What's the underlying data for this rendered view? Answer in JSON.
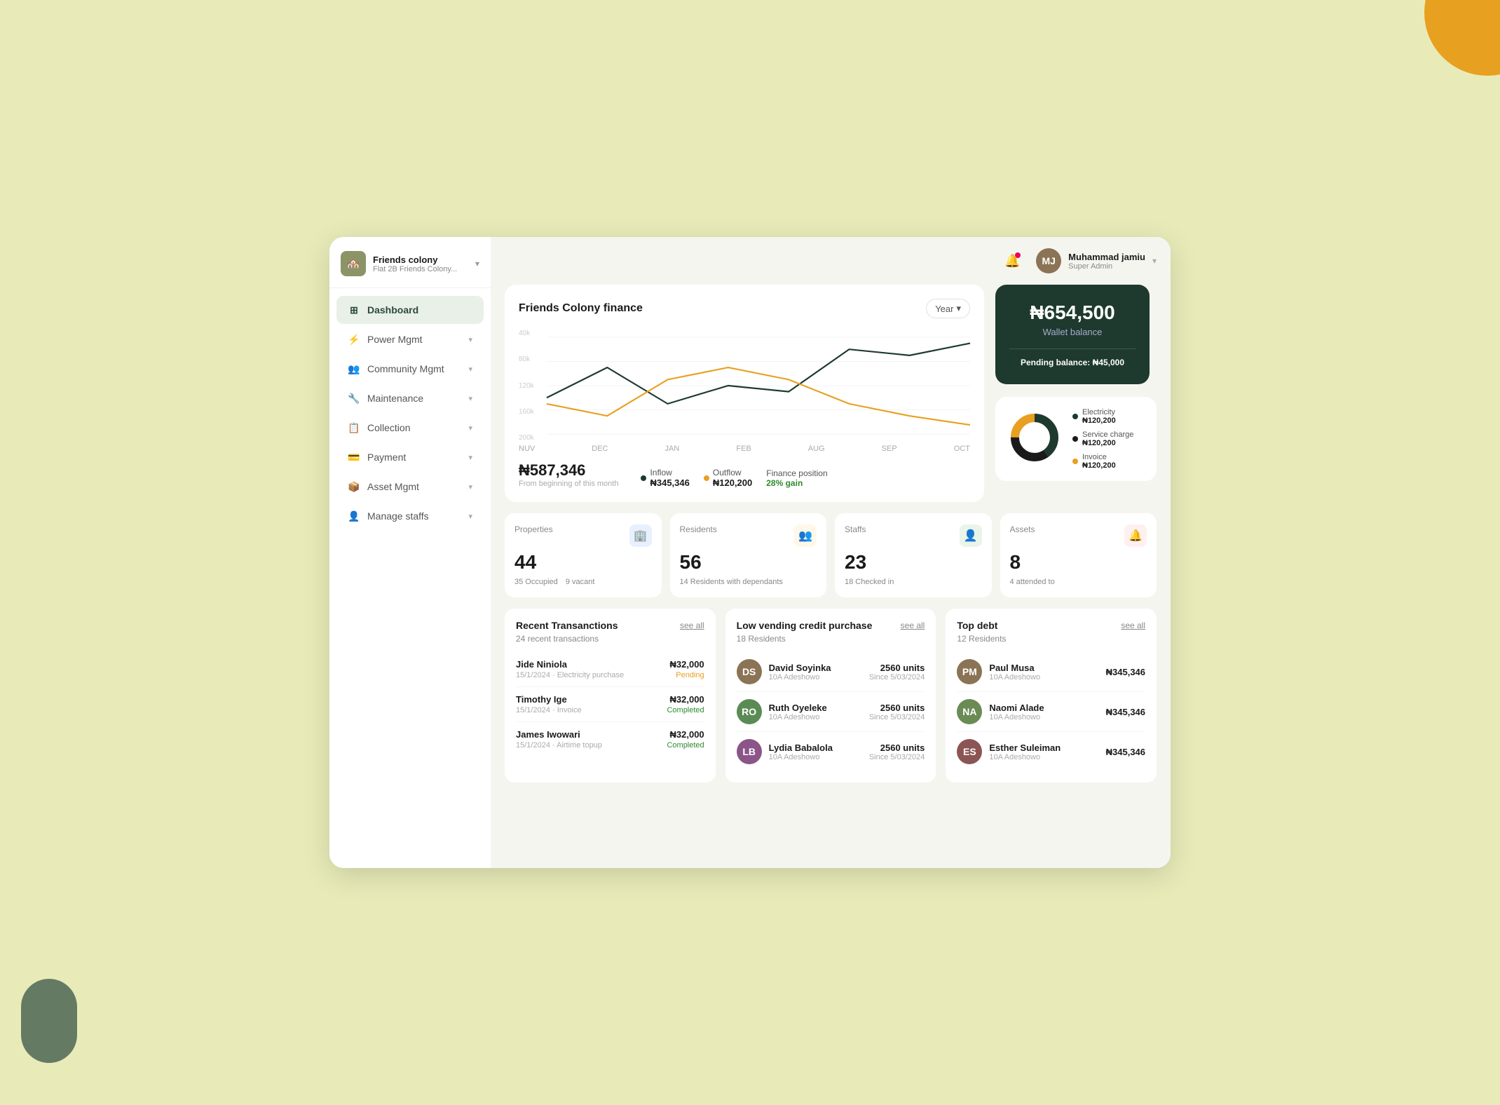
{
  "app": {
    "name": "Friends colony",
    "subtitle": "Flat 2B Friends Colony...",
    "bg_color": "#e8ebb8"
  },
  "user": {
    "name": "Muhammad jamiu",
    "role": "Super Admin",
    "initials": "MJ"
  },
  "sidebar": {
    "items": [
      {
        "id": "dashboard",
        "label": "Dashboard",
        "icon": "⊞",
        "active": true,
        "hasChevron": false
      },
      {
        "id": "power-mgmt",
        "label": "Power Mgmt",
        "icon": "⚡",
        "active": false,
        "hasChevron": true
      },
      {
        "id": "community-mgmt",
        "label": "Community Mgmt",
        "icon": "👥",
        "active": false,
        "hasChevron": true
      },
      {
        "id": "maintenance",
        "label": "Maintenance",
        "icon": "🔧",
        "active": false,
        "hasChevron": true
      },
      {
        "id": "collection",
        "label": "Collection",
        "icon": "📋",
        "active": false,
        "hasChevron": true
      },
      {
        "id": "payment",
        "label": "Payment",
        "icon": "💳",
        "active": false,
        "hasChevron": true
      },
      {
        "id": "asset-mgmt",
        "label": "Asset Mgmt",
        "icon": "📦",
        "active": false,
        "hasChevron": true
      },
      {
        "id": "manage-staffs",
        "label": "Manage staffs",
        "icon": "👤",
        "active": false,
        "hasChevron": true
      }
    ]
  },
  "finance": {
    "title": "Friends Colony finance",
    "year_label": "Year",
    "total_amount": "₦587,346",
    "total_sub": "From beginning of this month",
    "inflow_label": "Inflow",
    "inflow_value": "₦345,346",
    "outflow_label": "Outflow",
    "outflow_value": "₦120,200",
    "position_label": "Finance position",
    "position_value": "28% gain",
    "chart_x_labels": [
      "NUV",
      "DEC",
      "JAN",
      "FEB",
      "AUG",
      "SEP",
      "OCT"
    ],
    "chart_y_labels": [
      "40k",
      "80k",
      "120k",
      "160k",
      "200k"
    ]
  },
  "wallet": {
    "balance": "₦654,500",
    "balance_label": "Wallet balance",
    "pending_label": "Pending balance:",
    "pending_value": "₦45,000"
  },
  "donut": {
    "segments": [
      {
        "label": "Electricity",
        "value": "₦120,200",
        "color": "#1e3a2f",
        "percent": 40
      },
      {
        "label": "Service charge",
        "value": "₦120,200",
        "color": "#1a1a1a",
        "percent": 35
      },
      {
        "label": "Invoice",
        "value": "₦120,200",
        "color": "#e8a020",
        "percent": 25
      }
    ]
  },
  "stats": [
    {
      "id": "properties",
      "label": "Properties",
      "value": "44",
      "sub1": "35 Occupied",
      "sub2": "9 vacant",
      "icon_color": "#e8f0ff",
      "icon": "🏢"
    },
    {
      "id": "residents",
      "label": "Residents",
      "value": "56",
      "sub1": "14 Residents with dependants",
      "sub2": "",
      "icon_color": "#fff8e8",
      "icon": "👥"
    },
    {
      "id": "staffs",
      "label": "Staffs",
      "value": "23",
      "sub1": "18 Checked in",
      "sub2": "",
      "icon_color": "#e8f5e8",
      "icon": "👤"
    },
    {
      "id": "assets",
      "label": "Assets",
      "value": "8",
      "sub1": "4 attended to",
      "sub2": "",
      "icon_color": "#fff0f0",
      "icon": "🔔"
    }
  ],
  "recent_transactions": {
    "title": "Recent Transanctions",
    "see_all": "see all",
    "count": "24",
    "count_label": "recent transactions",
    "items": [
      {
        "name": "Jide Niniola",
        "date": "15/1/2024",
        "type": "Electricity purchase",
        "amount": "₦32,000",
        "status": "Pending",
        "status_class": "pending"
      },
      {
        "name": "Timothy Ige",
        "date": "15/1/2024",
        "type": "Invoice",
        "amount": "₦32,000",
        "status": "Completed",
        "status_class": "completed"
      },
      {
        "name": "James Iwowari",
        "date": "15/1/2024",
        "type": "Airtime topup",
        "amount": "₦32,000",
        "status": "Completed",
        "status_class": "completed"
      }
    ]
  },
  "low_vending": {
    "title": "Low vending credit purchase",
    "see_all": "see all",
    "count": "18",
    "count_label": "Residents",
    "items": [
      {
        "name": "David Soyinka",
        "location": "10A Adeshowo",
        "units": "2560 units",
        "since": "Since 5/03/2024",
        "avatar_color": "#8B7355"
      },
      {
        "name": "Ruth Oyeleke",
        "location": "10A Adeshowo",
        "units": "2560 units",
        "since": "Since 5/03/2024",
        "avatar_color": "#5B8B55"
      },
      {
        "name": "Lydia Babalola",
        "location": "10A Adeshowo",
        "units": "2560 units",
        "since": "Since 5/03/2024",
        "avatar_color": "#8B5588"
      }
    ]
  },
  "top_debt": {
    "title": "Top debt",
    "see_all": "see all",
    "count": "12",
    "count_label": "Residents",
    "items": [
      {
        "name": "Paul Musa",
        "location": "10A Adeshowo",
        "amount": "₦345,346",
        "avatar_color": "#8B7355"
      },
      {
        "name": "Naomi Alade",
        "location": "10A Adeshowo",
        "amount": "₦345,346",
        "avatar_color": "#6B8B55"
      },
      {
        "name": "Esther Suleiman",
        "location": "10A Adeshowo",
        "amount": "₦345,346",
        "avatar_color": "#8B5555"
      }
    ]
  }
}
